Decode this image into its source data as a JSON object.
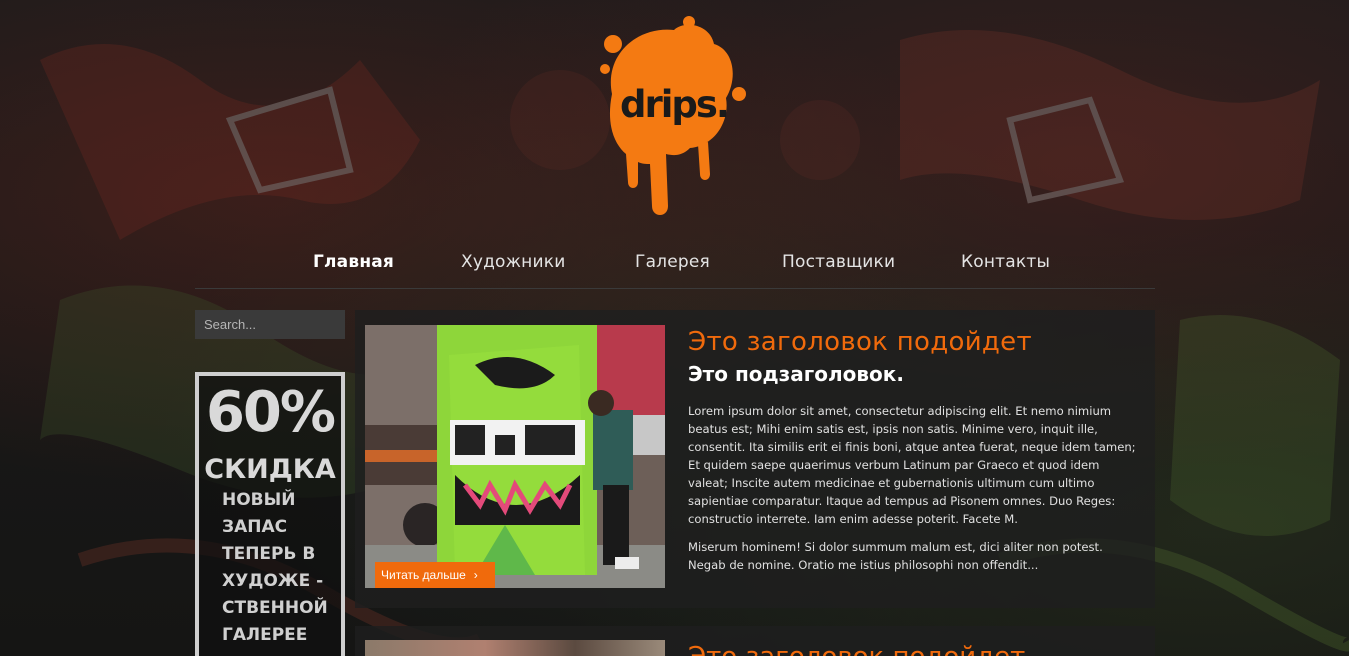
{
  "brand": {
    "logo_text": "drips.",
    "accent_color": "#f06a0c"
  },
  "nav": {
    "items": [
      {
        "label": "Главная",
        "active": true
      },
      {
        "label": "Художники",
        "active": false
      },
      {
        "label": "Галерея",
        "active": false
      },
      {
        "label": "Поставщики",
        "active": false
      },
      {
        "label": "Контакты",
        "active": false
      }
    ]
  },
  "sidebar": {
    "search": {
      "placeholder": "Search...",
      "value": ""
    },
    "promo": {
      "percent": "60%",
      "title": "СКИДКА",
      "lines": [
        "НОВЫЙ",
        "ЗАПАС",
        "ТЕПЕРЬ В",
        "ХУДОЖЕ -",
        "СТВЕННОЙ",
        "ГАЛЕРЕЕ"
      ]
    }
  },
  "articles": [
    {
      "title": "Это заголовок подойдет",
      "subtitle": "Это подзаголовок.",
      "paragraphs": [
        "Lorem ipsum dolor sit amet, consectetur adipiscing elit. Et nemo nimium beatus est; Mihi enim satis est, ipsis non satis. Minime vero, inquit ille, consentit. Ita similis erit ei finis boni, atque antea fuerat, neque idem tamen; Et quidem saepe quaerimus verbum Latinum par Graeco et quod idem valeat; Inscite autem medicinae et gubernationis ultimum cum ultimo sapientiae comparatur. Itaque ad tempus ad Pisonem omnes. Duo Reges: constructio interrete. Iam enim adesse poterit. Facete M.",
        "Miserum hominem! Si dolor summum malum est, dici aliter non potest. Negab de nomine. Oratio me istius philosophi non offendit..."
      ],
      "read_more": "Читать дальше",
      "read_more_arrow": "›"
    },
    {
      "title": "Это заголовок подойдет"
    }
  ]
}
